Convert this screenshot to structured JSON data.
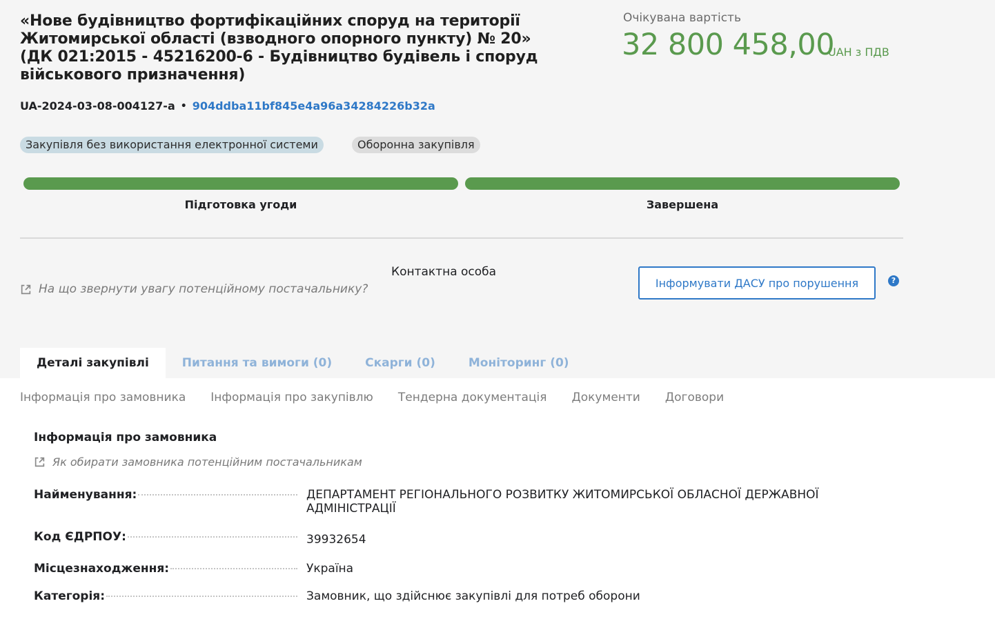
{
  "tender": {
    "title": "«Нове будівництво фортифікаційних споруд на території Житомирської області (взводного опорного пункту) № 20» (ДК 021:2015 - 45216200-6 - Будівництво будівель і споруд військового призначення)",
    "tender_id": "UA-2024-03-08-004127-a",
    "hash": "904ddba11bf845e4a96a34284226b32a"
  },
  "expected_value": {
    "label": "Очікувана вартість",
    "amount": "32 800 458,00",
    "currency": "UAH з ПДВ"
  },
  "badges": {
    "procurement_type": "Закупівля без використання електронної системи",
    "defense": "Оборонна закупівля"
  },
  "stages": {
    "stage1": "Підготовка угоди",
    "stage2": "Завершена"
  },
  "actions": {
    "supplier_hint": "На що звернути увагу потенційному постачальнику?",
    "contact_person": "Контактна особа",
    "dasu_button": "Інформувати ДАСУ про порушення",
    "help": "?"
  },
  "tabs": {
    "details": "Деталі закупівлі",
    "questions": "Питання та вимоги (0)",
    "complaints": "Скарги (0)",
    "monitoring": "Моніторинг (0)"
  },
  "subnav": {
    "customer_info": "Інформація про замовника",
    "procurement_info": "Інформація про закупівлю",
    "tender_docs": "Тендерна документація",
    "documents": "Документи",
    "contracts": "Договори"
  },
  "customer": {
    "section_title": "Інформація про замовника",
    "hint": "Як обирати замовника потенційним постачальникам",
    "name_label": "Найменування:",
    "name_value": "ДЕПАРТАМЕНТ РЕГІОНАЛЬНОГО РОЗВИТКУ ЖИТОМИРСЬКОЇ ОБЛАСНОЇ ДЕРЖАВНОЇ АДМІНІСТРАЦІЇ",
    "edrpou_label": "Код ЄДРПОУ:",
    "edrpou_value": "39932654",
    "location_label": "Місцезнаходження:",
    "location_value": "Україна",
    "category_label": "Категорія:",
    "category_value": "Замовник, що здійснює закупівлі для потреб оборони"
  },
  "colors": {
    "accent_green": "#5a9a4e",
    "link_blue": "#2e78c7",
    "inactive_tab": "#8fb3d9"
  }
}
